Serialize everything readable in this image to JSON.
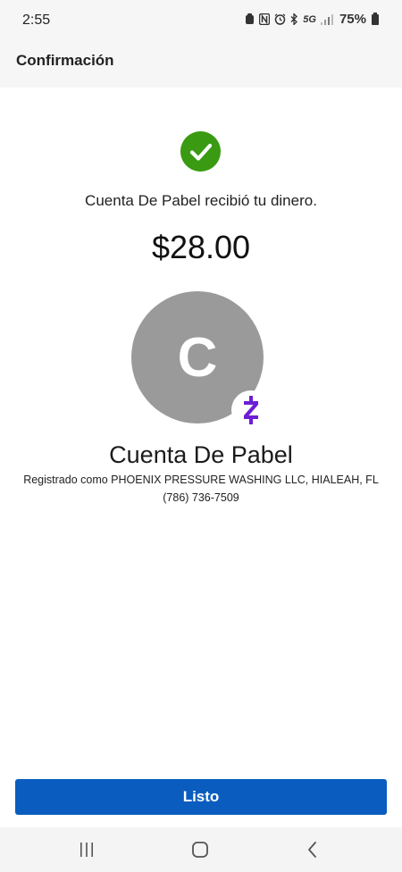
{
  "status_bar": {
    "time": "2:55",
    "network": "5G",
    "battery": "75%"
  },
  "header": {
    "title": "Confirmación"
  },
  "confirmation": {
    "message": "Cuenta De Pabel recibió tu dinero.",
    "amount": "$28.00",
    "success_color": "#3a9a12"
  },
  "recipient": {
    "initial": "C",
    "name": "Cuenta De Pabel",
    "registered_as": "Registrado como PHOENIX PRESSURE WASHING LLC, HIALEAH, FL",
    "phone": "(786) 736-7509",
    "badge_icon": "zelle-icon",
    "badge_color": "#6d1ed4"
  },
  "actions": {
    "done_label": "Listo",
    "button_color": "#0a5dbf"
  },
  "nav": {
    "recent": "recent-apps-icon",
    "home": "home-icon",
    "back": "back-icon"
  }
}
